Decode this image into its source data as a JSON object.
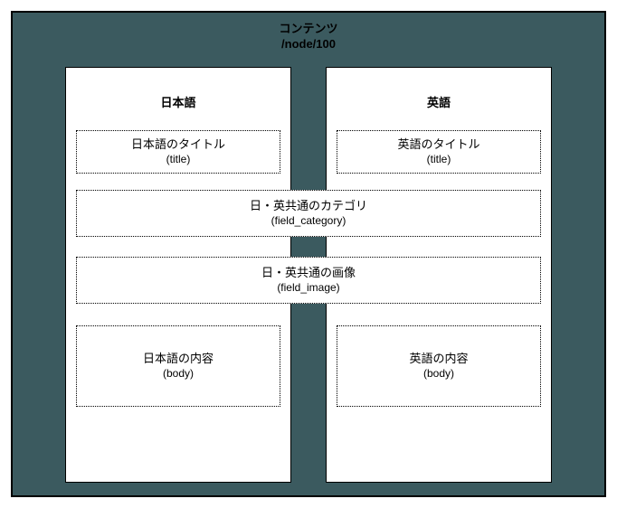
{
  "header": {
    "title": "コンテンツ",
    "path": "/node/100"
  },
  "columns": {
    "left": {
      "heading": "日本語",
      "title": {
        "label": "日本語のタイトル",
        "field": "(title)"
      },
      "body": {
        "label": "日本語の内容",
        "field": "(body)"
      }
    },
    "right": {
      "heading": "英語",
      "title": {
        "label": "英語のタイトル",
        "field": "(title)"
      },
      "body": {
        "label": "英語の内容",
        "field": "(body)"
      }
    }
  },
  "shared": {
    "category": {
      "label": "日・英共通のカテゴリ",
      "field": "(field_category)"
    },
    "image": {
      "label": "日・英共通の画像",
      "field": "(field_image)"
    }
  }
}
